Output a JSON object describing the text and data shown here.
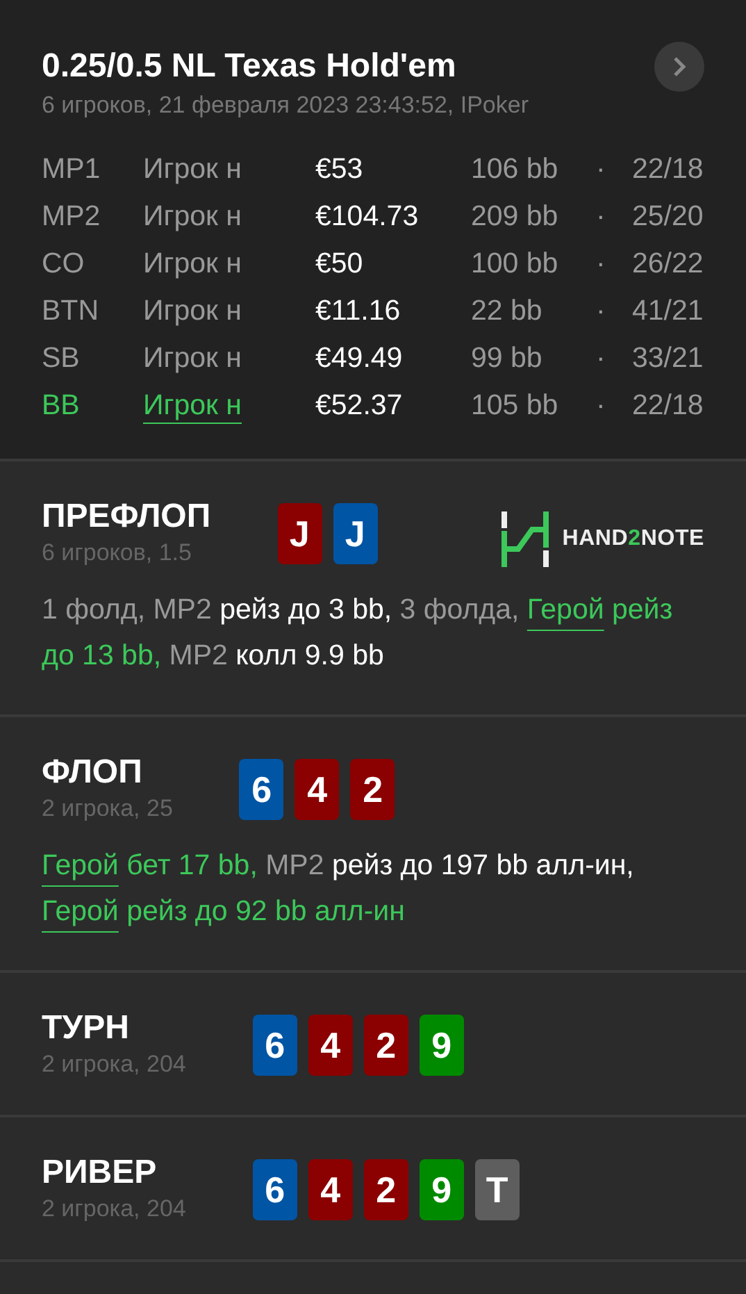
{
  "header": {
    "title": "0.25/0.5 NL Texas Hold'em",
    "subtitle": "6 игроков, 21 февраля 2023 23:43:52, IPoker"
  },
  "players": [
    {
      "position": "MP1",
      "name": "Игрок н",
      "stack": "€53",
      "bb": "106 bb",
      "separator": "·",
      "stats": "22/18",
      "hero": false
    },
    {
      "position": "MP2",
      "name": "Игрок н",
      "stack": "€104.73",
      "bb": "209 bb",
      "separator": "·",
      "stats": "25/20",
      "hero": false
    },
    {
      "position": "CO",
      "name": "Игрок н",
      "stack": "€50",
      "bb": "100 bb",
      "separator": "·",
      "stats": "26/22",
      "hero": false
    },
    {
      "position": "BTN",
      "name": "Игрок н",
      "stack": "€11.16",
      "bb": "22 bb",
      "separator": "·",
      "stats": "41/21",
      "hero": false
    },
    {
      "position": "SB",
      "name": "Игрок н",
      "stack": "€49.49",
      "bb": "99 bb",
      "separator": "·",
      "stats": "33/21",
      "hero": false
    },
    {
      "position": "BB",
      "name": "Игрок н",
      "stack": "€52.37",
      "bb": "105 bb",
      "separator": "·",
      "stats": "22/18",
      "hero": true
    }
  ],
  "logo": {
    "before": "HAND",
    "accent": "2",
    "after": "NOTE"
  },
  "streets": [
    {
      "title": "ПРЕФЛОП",
      "subtitle": "6 игроков, 1.5",
      "cards": [
        {
          "rank": "J",
          "color": "#8b0000"
        },
        {
          "rank": "J",
          "color": "#0055a5"
        }
      ],
      "actions": [
        {
          "kind": "info",
          "text": "1 фолд, MP2 "
        },
        {
          "kind": "action",
          "text": "рейз до 3 bb, "
        },
        {
          "kind": "info",
          "text": "3 фолда, "
        },
        {
          "kind": "hero",
          "text": "Герой"
        },
        {
          "kind": "hero_action",
          "text": " рейз до 13 bb, "
        },
        {
          "kind": "info",
          "text": "MP2 "
        },
        {
          "kind": "action",
          "text": "колл 9.9 bb"
        }
      ]
    },
    {
      "title": "ФЛОП",
      "subtitle": "2 игрока, 25",
      "cards": [
        {
          "rank": "6",
          "color": "#0055a5"
        },
        {
          "rank": "4",
          "color": "#8b0000"
        },
        {
          "rank": "2",
          "color": "#8b0000"
        }
      ],
      "actions": [
        {
          "kind": "hero",
          "text": "Герой"
        },
        {
          "kind": "hero_action",
          "text": " бет 17 bb, "
        },
        {
          "kind": "info",
          "text": "MP2 "
        },
        {
          "kind": "action",
          "text": "рейз до 197 bb алл-ин, "
        },
        {
          "kind": "hero",
          "text": "Герой"
        },
        {
          "kind": "hero_action",
          "text": " рейз до 92 bb алл-ин"
        }
      ]
    },
    {
      "title": "ТУРН",
      "subtitle": "2 игрока, 204",
      "cards": [
        {
          "rank": "6",
          "color": "#0055a5"
        },
        {
          "rank": "4",
          "color": "#8b0000"
        },
        {
          "rank": "2",
          "color": "#8b0000"
        },
        {
          "rank": "9",
          "color": "#008a00"
        }
      ]
    },
    {
      "title": "РИВЕР",
      "subtitle": "2 игрока, 204",
      "cards": [
        {
          "rank": "6",
          "color": "#0055a5"
        },
        {
          "rank": "4",
          "color": "#8b0000"
        },
        {
          "rank": "2",
          "color": "#8b0000"
        },
        {
          "rank": "9",
          "color": "#008a00"
        },
        {
          "rank": "T",
          "color": "#5e5e5e"
        }
      ]
    }
  ]
}
